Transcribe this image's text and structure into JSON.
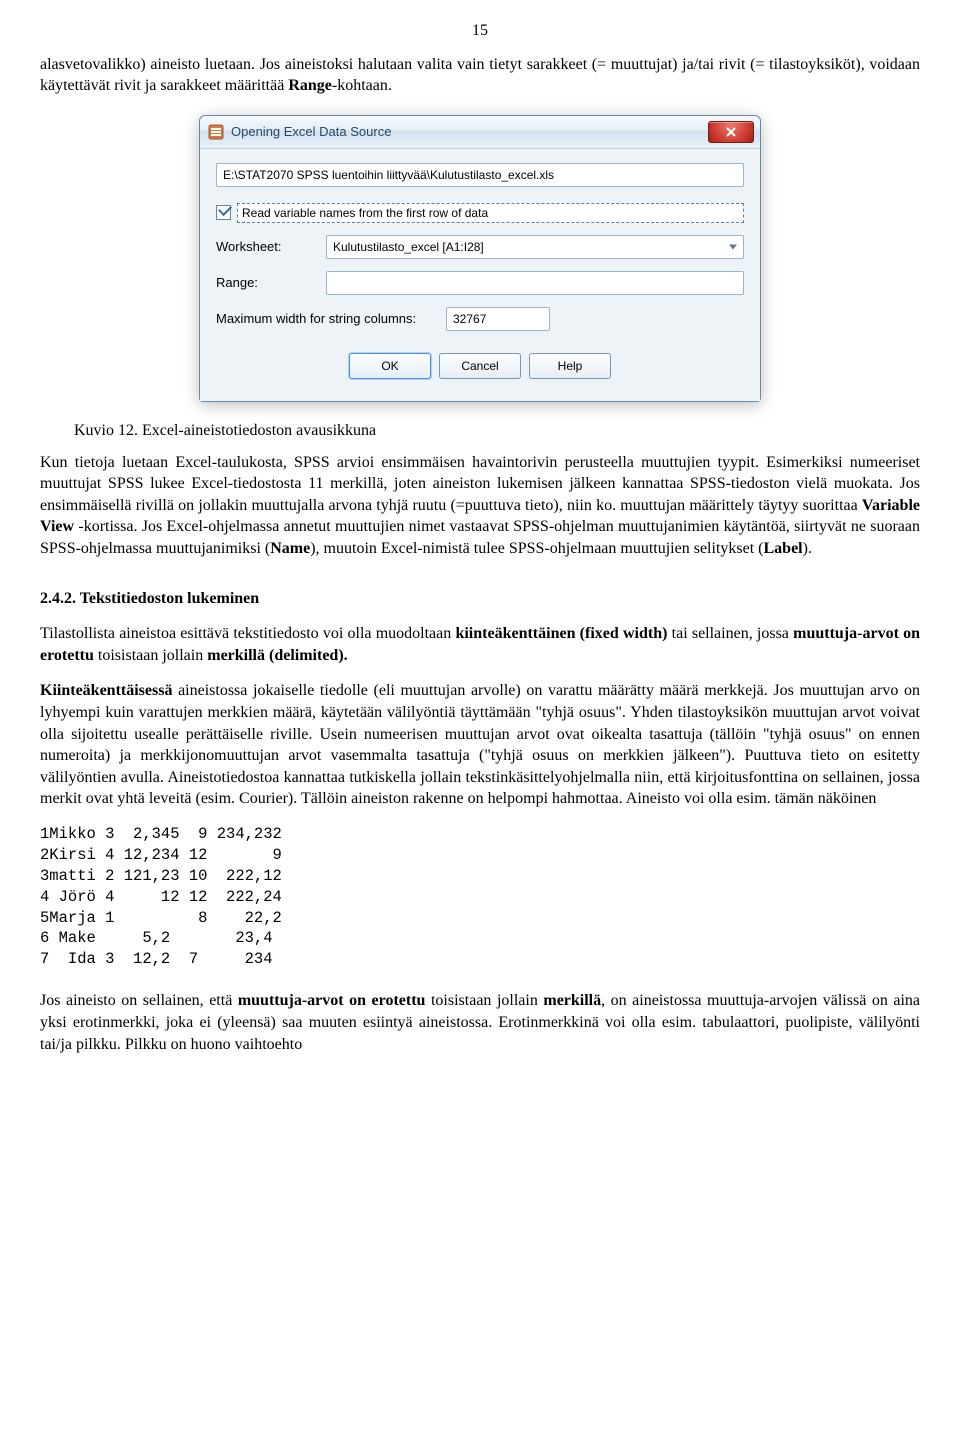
{
  "page_number": "15",
  "para1": "alasvetovalikko) aineisto luetaan. Jos aineistoksi halutaan valita vain tietyt sarakkeet (= muuttujat) ja/tai rivit (= tilastoyksiköt), voidaan käytettävät rivit ja sarakkeet määrittää ",
  "para1_bold_tail": "Range",
  "para1_tail": "-kohtaan.",
  "dialog": {
    "title": "Opening Excel Data Source",
    "path": "E:\\STAT2070 SPSS luentoihin liittyvää\\Kulutustilasto_excel.xls",
    "read_first_row": "Read variable names from the first row of data",
    "worksheet_label": "Worksheet:",
    "worksheet_value": "Kulutustilasto_excel [A1:I28]",
    "range_label": "Range:",
    "range_value": "",
    "maxwidth_label": "Maximum width for string columns:",
    "maxwidth_value": "32767",
    "ok": "OK",
    "cancel": "Cancel",
    "help": "Help"
  },
  "caption": "Kuvio 12. Excel-aineistotiedoston avausikkuna",
  "para2_a": "Kun tietoja luetaan Excel-taulukosta, SPSS arvioi ensimmäisen havaintorivin perusteella muuttujien tyypit. Esimerkiksi numeeriset muuttujat SPSS lukee Excel-tiedostosta 11 merkillä, joten aineiston lukemisen jälkeen kannattaa SPSS-tiedoston vielä muokata. Jos ensimmäisellä rivillä on jollakin muuttujalla arvona tyhjä ruutu (=puuttuva tieto), niin ko. muuttujan määrittely täytyy suorittaa ",
  "para2_b_bold": "Variable View",
  "para2_c": " -kortissa. Jos Excel-ohjelmassa annetut muuttujien nimet vastaavat SPSS-ohjelman muuttujanimien käytäntöä, siirtyvät ne suoraan SPSS-ohjelmassa muuttujanimiksi (",
  "para2_d_bold": "Name",
  "para2_e": "), muutoin Excel-nimistä tulee SPSS-ohjelmaan muuttujien selitykset (",
  "para2_f_bold": "Label",
  "para2_g": ").",
  "heading": "2.4.2. Tekstitiedoston lukeminen",
  "para3_a": "Tilastollista aineistoa esittävä tekstitiedosto voi olla muodoltaan ",
  "para3_b_bold": "kiinteäkenttäinen (fixed width)",
  "para3_c": " tai sellainen, jossa ",
  "para3_d_bold": "muuttuja-arvot on erotettu",
  "para3_e": " toisistaan jollain ",
  "para3_f_bold": "merkillä (delimited).",
  "para4_a_bold": "Kiinteäkenttäisessä",
  "para4_b": " aineistossa jokaiselle tiedolle (eli muuttujan arvolle) on varattu määrätty määrä merkkejä. Jos muuttujan arvo on lyhyempi kuin varattujen merkkien määrä, käytetään välilyöntiä täyttämään \"tyhjä osuus\". Yhden tilastoyksikön muuttujan arvot voivat olla sijoitettu usealle perättäiselle riville. Usein numeerisen muuttujan arvot ovat oikealta tasattuja (tällöin \"tyhjä osuus\" on ennen numeroita) ja merkkijonomuuttujan arvot vasemmalta tasattuja (\"tyhjä osuus on merkkien jälkeen\"). Puuttuva tieto on esitetty välilyöntien avulla. Aineistotiedostoa kannattaa tutkiskella jollain tekstinkäsittelyohjelmalla niin, että kirjoitusfonttina on sellainen, jossa merkit ovat yhtä leveitä (esim. Courier). Tällöin aineiston rakenne on helpompi hahmottaa. Aineisto voi olla esim. tämän näköinen",
  "fixed_block": "1Mikko 3  2,345  9 234,232\n2Kirsi 4 12,234 12       9\n3matti 2 121,23 10  222,12\n4 Jörö 4     12 12  222,24\n5Marja 1         8    22,2\n6 Make     5,2       23,4\n7  Ida 3  12,2  7     234",
  "para5_a": "Jos aineisto on sellainen, että ",
  "para5_b_bold": "muuttuja-arvot on erotettu",
  "para5_c": " toisistaan jollain ",
  "para5_d_bold": "merkillä",
  "para5_e": ", on aineistossa muuttuja-arvojen välissä on aina yksi erotinmerkki, joka ei (yleensä) saa muuten esiintyä aineistossa. Erotinmerkkinä voi olla esim. tabulaattori, puolipiste, välilyönti tai/ja pilkku. Pilkku on huono vaihtoehto"
}
